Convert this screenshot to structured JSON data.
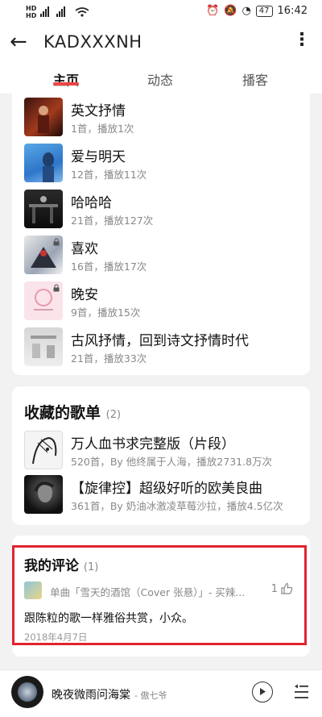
{
  "status": {
    "sim1": "HD",
    "sim2": "HD",
    "signal": "⁴⁶ ᵢₗ ⁴⁶ ᵢₗ",
    "battery": "47",
    "time": "16:42"
  },
  "header": {
    "back_label": "←",
    "title": "KADXXXNH",
    "more_label": "⋮"
  },
  "tabs": [
    {
      "label": "主页"
    },
    {
      "label": "动态"
    },
    {
      "label": "播客"
    }
  ],
  "created_playlists": [
    {
      "name": "英文抒情",
      "meta": "1首，播放1次"
    },
    {
      "name": "爱与明天",
      "meta": "12首，播放11次"
    },
    {
      "name": "哈哈哈",
      "meta": "21首，播放127次"
    },
    {
      "name": "喜欢",
      "meta": "16首，播放17次"
    },
    {
      "name": "晚安",
      "meta": "9首，播放15次"
    },
    {
      "name": "古风抒情，回到诗文抒情时代",
      "meta": "21首，播放33次"
    }
  ],
  "collected": {
    "title": "收藏的歌单",
    "count": "(2)",
    "items": [
      {
        "name": "万人血书求完整版（片段）",
        "meta": "520首，By 他终属于人海，播放2731.8万次"
      },
      {
        "name": "【旋律控】超级好听的欧美良曲",
        "meta": "361首，By 奶油冰激凌草莓沙拉，播放4.5亿次"
      }
    ]
  },
  "comments": {
    "title": "我的评论",
    "count": "(1)",
    "source": "单曲「雪天的酒馆（Cover 张悬）」- 买辣...",
    "likes": "1",
    "text": "跟陈粒的歌一样雅俗共赏，小众。",
    "date": "2018年4月7日"
  },
  "player": {
    "song": "晚夜微雨问海棠",
    "artist": "- 傲七爷"
  },
  "colors": {
    "accent": "#e44444",
    "highlight_box": "#e0242e"
  }
}
